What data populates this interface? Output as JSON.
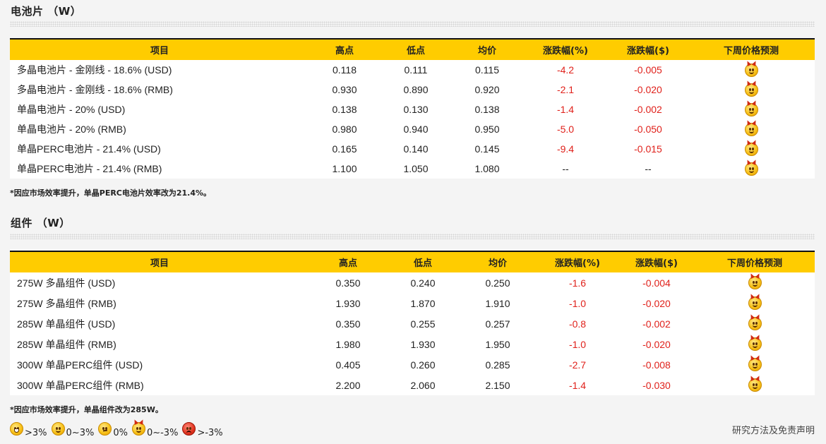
{
  "cell_section": {
    "title": "电池片 （W）",
    "headers": [
      "项目",
      "高点",
      "低点",
      "均价",
      "涨跌幅(%)",
      "涨跌幅($)",
      "下周价格预测"
    ],
    "rows": [
      {
        "name": "多晶电池片 - 金刚线 - 18.6% (USD)",
        "high": "0.118",
        "low": "0.111",
        "avg": "0.115",
        "pct": "-4.2",
        "usd": "-0.005",
        "forecast": "devil-smiley-icon"
      },
      {
        "name": "多晶电池片 - 金刚线 - 18.6% (RMB)",
        "high": "0.930",
        "low": "0.890",
        "avg": "0.920",
        "pct": "-2.1",
        "usd": "-0.020",
        "forecast": "devil-smiley-icon"
      },
      {
        "name": "单晶电池片 - 20% (USD)",
        "high": "0.138",
        "low": "0.130",
        "avg": "0.138",
        "pct": "-1.4",
        "usd": "-0.002",
        "forecast": "devil-smiley-icon"
      },
      {
        "name": "单晶电池片 - 20% (RMB)",
        "high": "0.980",
        "low": "0.940",
        "avg": "0.950",
        "pct": "-5.0",
        "usd": "-0.050",
        "forecast": "devil-smiley-icon"
      },
      {
        "name": "单晶PERC电池片 - 21.4% (USD)",
        "high": "0.165",
        "low": "0.140",
        "avg": "0.145",
        "pct": "-9.4",
        "usd": "-0.015",
        "forecast": "devil-smiley-icon"
      },
      {
        "name": "单晶PERC电池片 - 21.4% (RMB)",
        "high": "1.100",
        "low": "1.050",
        "avg": "1.080",
        "pct": "--",
        "usd": "--",
        "forecast": "devil-smiley-icon"
      }
    ],
    "note": "*因应市场效率提升，单晶PERC电池片效率改为21.4%。"
  },
  "module_section": {
    "title": "组件 （W）",
    "headers": [
      "项目",
      "高点",
      "低点",
      "均价",
      "涨跌幅(%)",
      "涨跌幅($)",
      "下周价格预测"
    ],
    "rows": [
      {
        "name": "275W 多晶组件 (USD)",
        "high": "0.350",
        "low": "0.240",
        "avg": "0.250",
        "pct": "-1.6",
        "usd": "-0.004",
        "forecast": "devil-smiley-icon"
      },
      {
        "name": "275W 多晶组件 (RMB)",
        "high": "1.930",
        "low": "1.870",
        "avg": "1.910",
        "pct": "-1.0",
        "usd": "-0.020",
        "forecast": "devil-smiley-icon"
      },
      {
        "name": "285W 单晶组件 (USD)",
        "high": "0.350",
        "low": "0.255",
        "avg": "0.257",
        "pct": "-0.8",
        "usd": "-0.002",
        "forecast": "devil-smiley-icon"
      },
      {
        "name": "285W 单晶组件 (RMB)",
        "high": "1.980",
        "low": "1.930",
        "avg": "1.950",
        "pct": "-1.0",
        "usd": "-0.020",
        "forecast": "devil-smiley-icon"
      },
      {
        "name": "300W 单晶PERC组件 (USD)",
        "high": "0.405",
        "low": "0.260",
        "avg": "0.285",
        "pct": "-2.7",
        "usd": "-0.008",
        "forecast": "devil-smiley-icon"
      },
      {
        "name": "300W 单晶PERC组件 (RMB)",
        "high": "2.200",
        "low": "2.060",
        "avg": "2.150",
        "pct": "-1.4",
        "usd": "-0.030",
        "forecast": "devil-smiley-icon"
      }
    ],
    "note": "*因应市场效率提升，单晶组件改为285W。"
  },
  "legend": [
    {
      "icon": "grin-smiley-icon",
      "label": ">3%"
    },
    {
      "icon": "smile-smiley-icon",
      "label": "0~3%"
    },
    {
      "icon": "neutral-smiley-icon",
      "label": "0%"
    },
    {
      "icon": "devil-smiley-icon",
      "label": "0~-3%"
    },
    {
      "icon": "angry-smiley-icon",
      "label": ">-3%"
    }
  ],
  "footer_link": "研究方法及免责声明",
  "colors": {
    "header_bg": "#ffcc00",
    "negative": "#e0211b",
    "page_bg": "#f4f4f4"
  }
}
